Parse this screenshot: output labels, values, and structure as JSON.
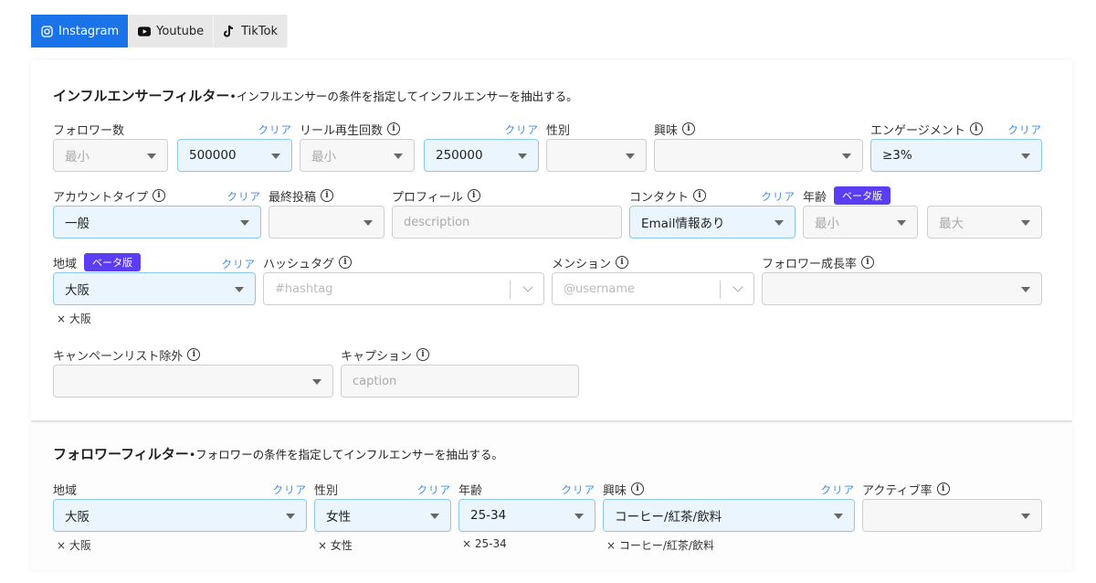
{
  "tabs": [
    {
      "label": "Instagram",
      "icon": "instagram-icon",
      "active": true
    },
    {
      "label": "Youtube",
      "icon": "youtube-icon",
      "active": false
    },
    {
      "label": "TikTok",
      "icon": "tiktok-icon",
      "active": false
    }
  ],
  "clear_label": "クリア",
  "beta_label": "ベータ版",
  "influencer_filter": {
    "title": "インフルエンサーフィルター",
    "description": "•インフルエンサーの条件を指定してインフルエンサーを抽出する。",
    "followers": {
      "label": "フォロワー数",
      "min_placeholder": "最小",
      "max_value": "500000"
    },
    "reel_views": {
      "label": "リール再生回数",
      "min_placeholder": "最小",
      "max_value": "250000"
    },
    "gender": {
      "label": "性別",
      "value": ""
    },
    "interests": {
      "label": "興味",
      "value": ""
    },
    "engagement": {
      "label": "エンゲージメント",
      "value": "≥3%"
    },
    "account_type": {
      "label": "アカウントタイプ",
      "value": "一般"
    },
    "last_post": {
      "label": "最終投稿",
      "value": ""
    },
    "profile": {
      "label": "プロフィール",
      "placeholder": "description"
    },
    "contact": {
      "label": "コンタクト",
      "value": "Email情報あり"
    },
    "age": {
      "label": "年齢",
      "min_placeholder": "最小",
      "max_placeholder": "最大"
    },
    "region": {
      "label": "地域",
      "value": "大阪",
      "chips": [
        "× 大阪"
      ]
    },
    "hashtag": {
      "label": "ハッシュタグ",
      "placeholder": "#hashtag"
    },
    "mention": {
      "label": "メンション",
      "placeholder": "@username"
    },
    "follower_growth": {
      "label": "フォロワー成長率",
      "value": ""
    },
    "campaign_exclude": {
      "label": "キャンペーンリスト除外",
      "value": ""
    },
    "caption": {
      "label": "キャプション",
      "placeholder": "caption"
    }
  },
  "follower_filter": {
    "title": "フォロワーフィルター",
    "description": "•フォロワーの条件を指定してインフルエンサーを抽出する。",
    "region": {
      "label": "地域",
      "value": "大阪",
      "chip": "× 大阪"
    },
    "gender": {
      "label": "性別",
      "value": "女性",
      "chip": "× 女性"
    },
    "age": {
      "label": "年齢",
      "value": "25-34",
      "chip": "× 25-34"
    },
    "interests": {
      "label": "興味",
      "value": "コーヒー/紅茶/飲料",
      "chip": "× コーヒー/紅茶/飲料"
    },
    "active_rate": {
      "label": "アクティブ率",
      "value": ""
    }
  }
}
